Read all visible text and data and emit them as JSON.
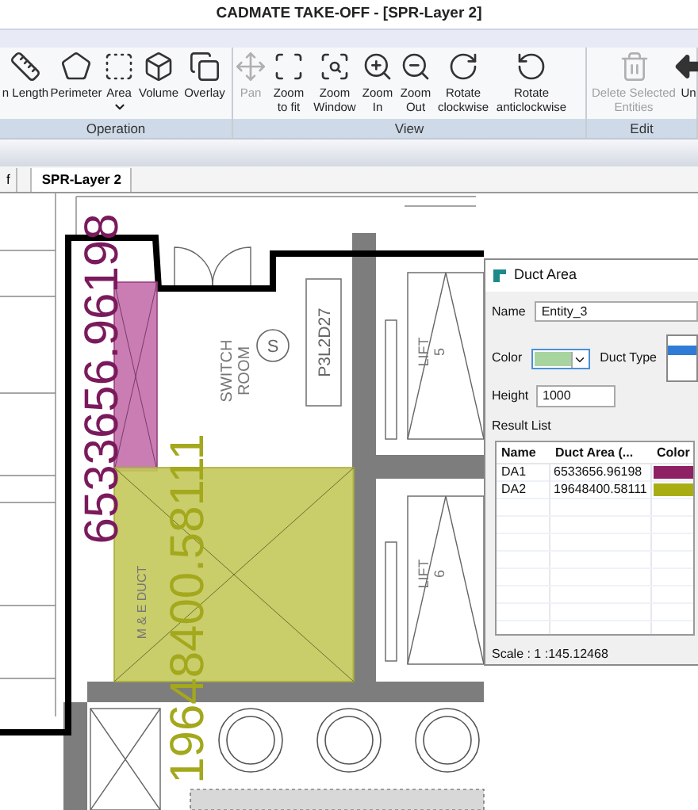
{
  "window": {
    "title": "CADMATE TAKE-OFF - [SPR-Layer 2]"
  },
  "ribbon": {
    "groups": [
      {
        "label": "Operation",
        "tools": [
          {
            "label": "n Length",
            "disabled": false
          },
          {
            "label": "Perimeter",
            "disabled": false
          },
          {
            "label": "Area",
            "disabled": false,
            "dropdown": true
          },
          {
            "label": "Volume",
            "disabled": false
          },
          {
            "label": "Overlay",
            "disabled": false
          }
        ]
      },
      {
        "label": "View",
        "tools": [
          {
            "label": "Pan",
            "disabled": true
          },
          {
            "label": "Zoom to fit",
            "disabled": false
          },
          {
            "label": "Zoom Window",
            "disabled": false
          },
          {
            "label": "Zoom In",
            "disabled": false
          },
          {
            "label": "Zoom Out",
            "disabled": false
          },
          {
            "label": "Rotate clockwise",
            "disabled": false
          },
          {
            "label": "Rotate anticlockwise",
            "disabled": false
          }
        ]
      },
      {
        "label": "Edit",
        "tools": [
          {
            "label": "Delete Selected Entities",
            "disabled": true
          },
          {
            "label": "Un",
            "disabled": false
          }
        ]
      }
    ]
  },
  "document_tabs": [
    {
      "label": "f",
      "selected": false
    },
    {
      "label": "SPR-Layer 2",
      "selected": true
    }
  ],
  "drawing": {
    "area_labels": [
      {
        "text": "6533656.96198",
        "color": "#7a1a5c"
      },
      {
        "text": "19648400.58111",
        "color": "#a3a81c"
      }
    ],
    "room_labels": [
      {
        "lines": [
          "SWITCH",
          "ROOM"
        ]
      },
      {
        "lines": [
          "LIFT",
          "5"
        ]
      },
      {
        "lines": [
          "LIFT",
          "6"
        ]
      },
      {
        "lines": [
          "M & E DUCT"
        ]
      }
    ],
    "symbol": "S",
    "tag": "P3L2D27"
  },
  "dialog": {
    "title": "Duct Area",
    "name_label": "Name",
    "name_value": "Entity_3",
    "color_label": "Color",
    "color": "#a8d4a0",
    "duct_type_label": "Duct Type",
    "height_label": "Height",
    "height_value": "1000",
    "result_label": "Result List",
    "columns": [
      "Name",
      "Duct Area (...",
      "Color"
    ],
    "rows": [
      {
        "name": "DA1",
        "area": "6533656.96198",
        "color": "#8e2163"
      },
      {
        "name": "DA2",
        "area": "19648400.58111",
        "color": "#a9ad14"
      }
    ],
    "scale": "Scale : 1 :145.12468"
  }
}
